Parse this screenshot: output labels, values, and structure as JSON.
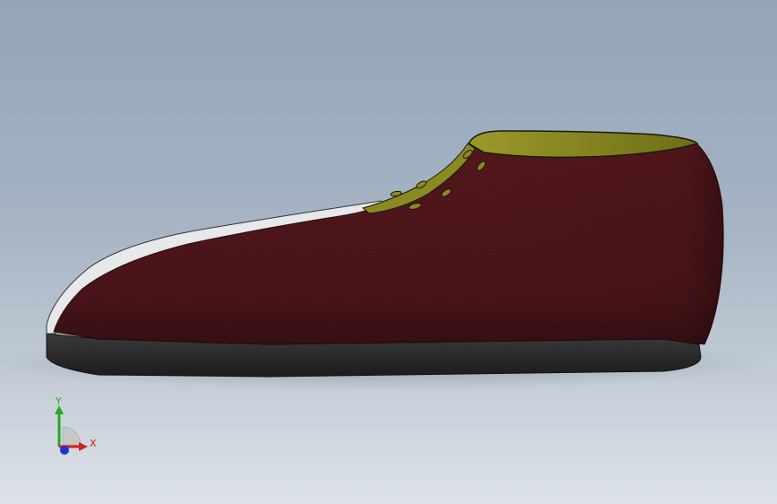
{
  "viewport": {
    "background_top": "#94a5b9",
    "background_bottom": "#dde2e9"
  },
  "model": {
    "upper_color": "#5a1a1f",
    "lining_color": "#8a8a22",
    "sole_color": "#2a2a2a",
    "welt_color": "#e6e8ea"
  },
  "triad": {
    "y_label": "Y",
    "x_label": "X",
    "y_color": "#22aa22",
    "x_color": "#cc2222",
    "z_color": "#2233cc"
  }
}
